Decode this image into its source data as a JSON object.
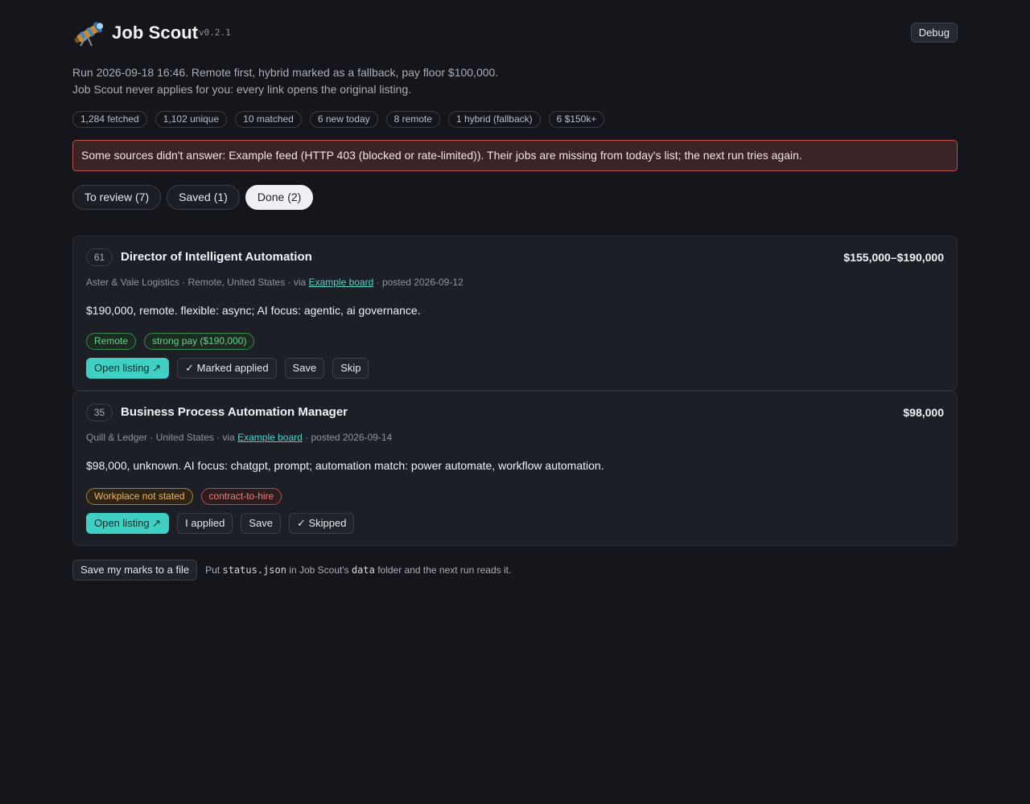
{
  "app": {
    "title": "Job Scout",
    "version": "v0.2.1",
    "debug_label": "Debug",
    "logo_icon": "telescope-icon"
  },
  "run": {
    "line1": "Run 2026-09-18 16:46. Remote first, hybrid marked as a fallback, pay floor $100,000.",
    "line2": "Job Scout never applies for you: every link opens the original listing."
  },
  "stats": [
    "1,284 fetched",
    "1,102 unique",
    "10 matched",
    "6 new today",
    "8 remote",
    "1 hybrid (fallback)",
    "6 $150k+"
  ],
  "alert": {
    "text": "Some sources didn't answer: Example feed (HTTP 403 (blocked or rate-limited)). Their jobs are missing from today's list; the next run tries again.",
    "color": "#c0504a"
  },
  "tabs": [
    {
      "label": "To review (7)",
      "active": false
    },
    {
      "label": "Saved (1)",
      "active": false
    },
    {
      "label": "Done (2)",
      "active": true
    }
  ],
  "jobs": [
    {
      "score": "61",
      "title": "Director of Intelligent Automation",
      "pay": "$155,000–$190,000",
      "company_loc": "Aster & Vale Logistics · Remote, United States · via ",
      "source": "Example board",
      "posted": " · posted 2026-09-12",
      "summary": "$190,000, remote. flexible: async; AI focus: agentic, ai governance.",
      "tags": [
        {
          "label": "Remote",
          "tone": "green"
        },
        {
          "label": "strong pay ($190,000)",
          "tone": "green"
        }
      ],
      "actions": [
        "Open listing ↗",
        "✓ Marked applied",
        "Save",
        "Skip"
      ]
    },
    {
      "score": "35",
      "title": "Business Process Automation Manager",
      "pay": "$98,000",
      "company_loc": "Quill & Ledger · United States · via ",
      "source": "Example board",
      "posted": " · posted 2026-09-14",
      "summary": "$98,000, unknown. AI focus: chatgpt, prompt; automation match: power automate, workflow automation.",
      "tags": [
        {
          "label": "Workplace not stated",
          "tone": "orange"
        },
        {
          "label": "contract-to-hire",
          "tone": "red"
        }
      ],
      "actions": [
        "Open listing ↗",
        "I applied",
        "Save",
        "✓ Skipped"
      ]
    }
  ],
  "footer": {
    "button": "Save my marks to a file",
    "note_pre": "Put ",
    "note_file": "status.json",
    "note_mid": " in Job Scout's ",
    "note_folder": "data",
    "note_post": " folder and the next run reads it."
  },
  "colors": {
    "accent": "#3fd0c3",
    "background": "#14161b",
    "card": "#1c1f26"
  }
}
